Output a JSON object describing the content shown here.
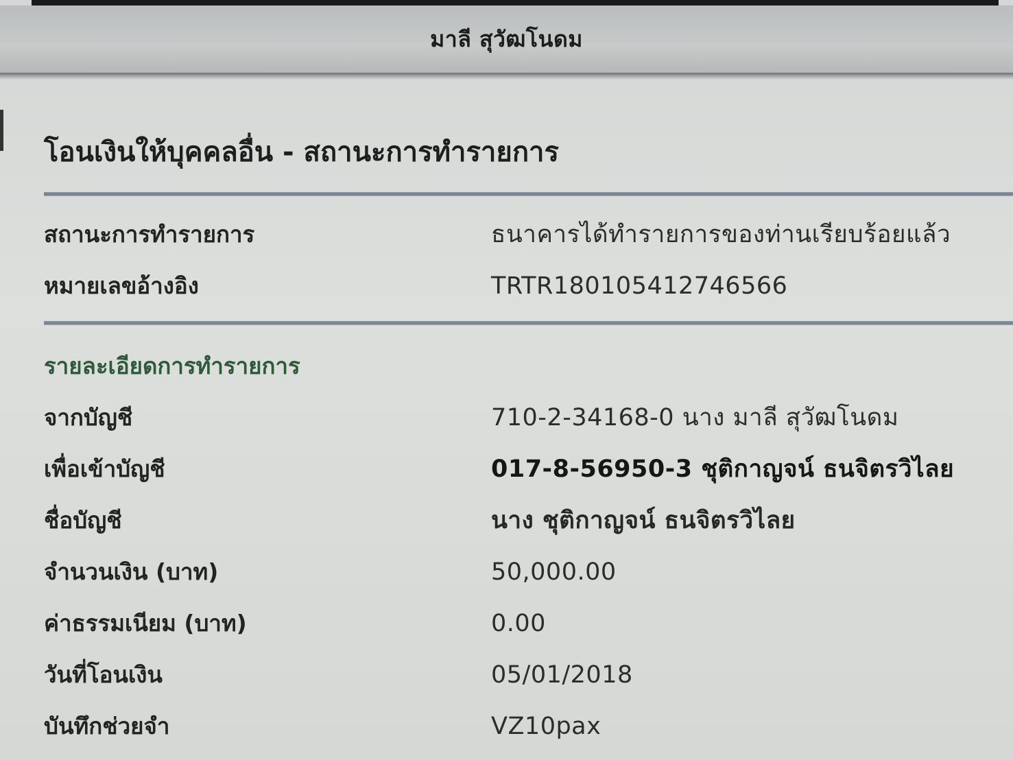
{
  "header": {
    "user_name": "มาลี สุวัฒโนดม"
  },
  "page": {
    "title": "โอนเงินให้บุคคลอื่น - สถานะการทำรายการ"
  },
  "status_block": {
    "rows": [
      {
        "label": "สถานะการทำรายการ",
        "value": "ธนาคารได้ทำรายการของท่านเรียบร้อยแล้ว"
      },
      {
        "label": "หมายเลขอ้างอิง",
        "value": "TRTR180105412746566"
      }
    ]
  },
  "details_block": {
    "section_title": "รายละเอียดการทำรายการ",
    "rows": [
      {
        "label": "จากบัญชี",
        "value": "710-2-34168-0 นาง มาลี สุวัฒโนดม"
      },
      {
        "label": "เพื่อเข้าบัญชี",
        "value": "017-8-56950-3 ชุติกาญจน์ ธนจิตรวิไลย"
      },
      {
        "label": "ชื่อบัญชี",
        "value": "นาง ชุติกาญจน์ ธนจิตรวิไลย"
      },
      {
        "label": "จำนวนเงิน (บาท)",
        "value": "50,000.00"
      },
      {
        "label": "ค่าธรรมเนียม (บาท)",
        "value": "0.00"
      },
      {
        "label": "วันที่โอนเงิน",
        "value": "05/01/2018"
      },
      {
        "label": "บันทึกช่วยจำ",
        "value": "VZ10pax"
      }
    ]
  }
}
